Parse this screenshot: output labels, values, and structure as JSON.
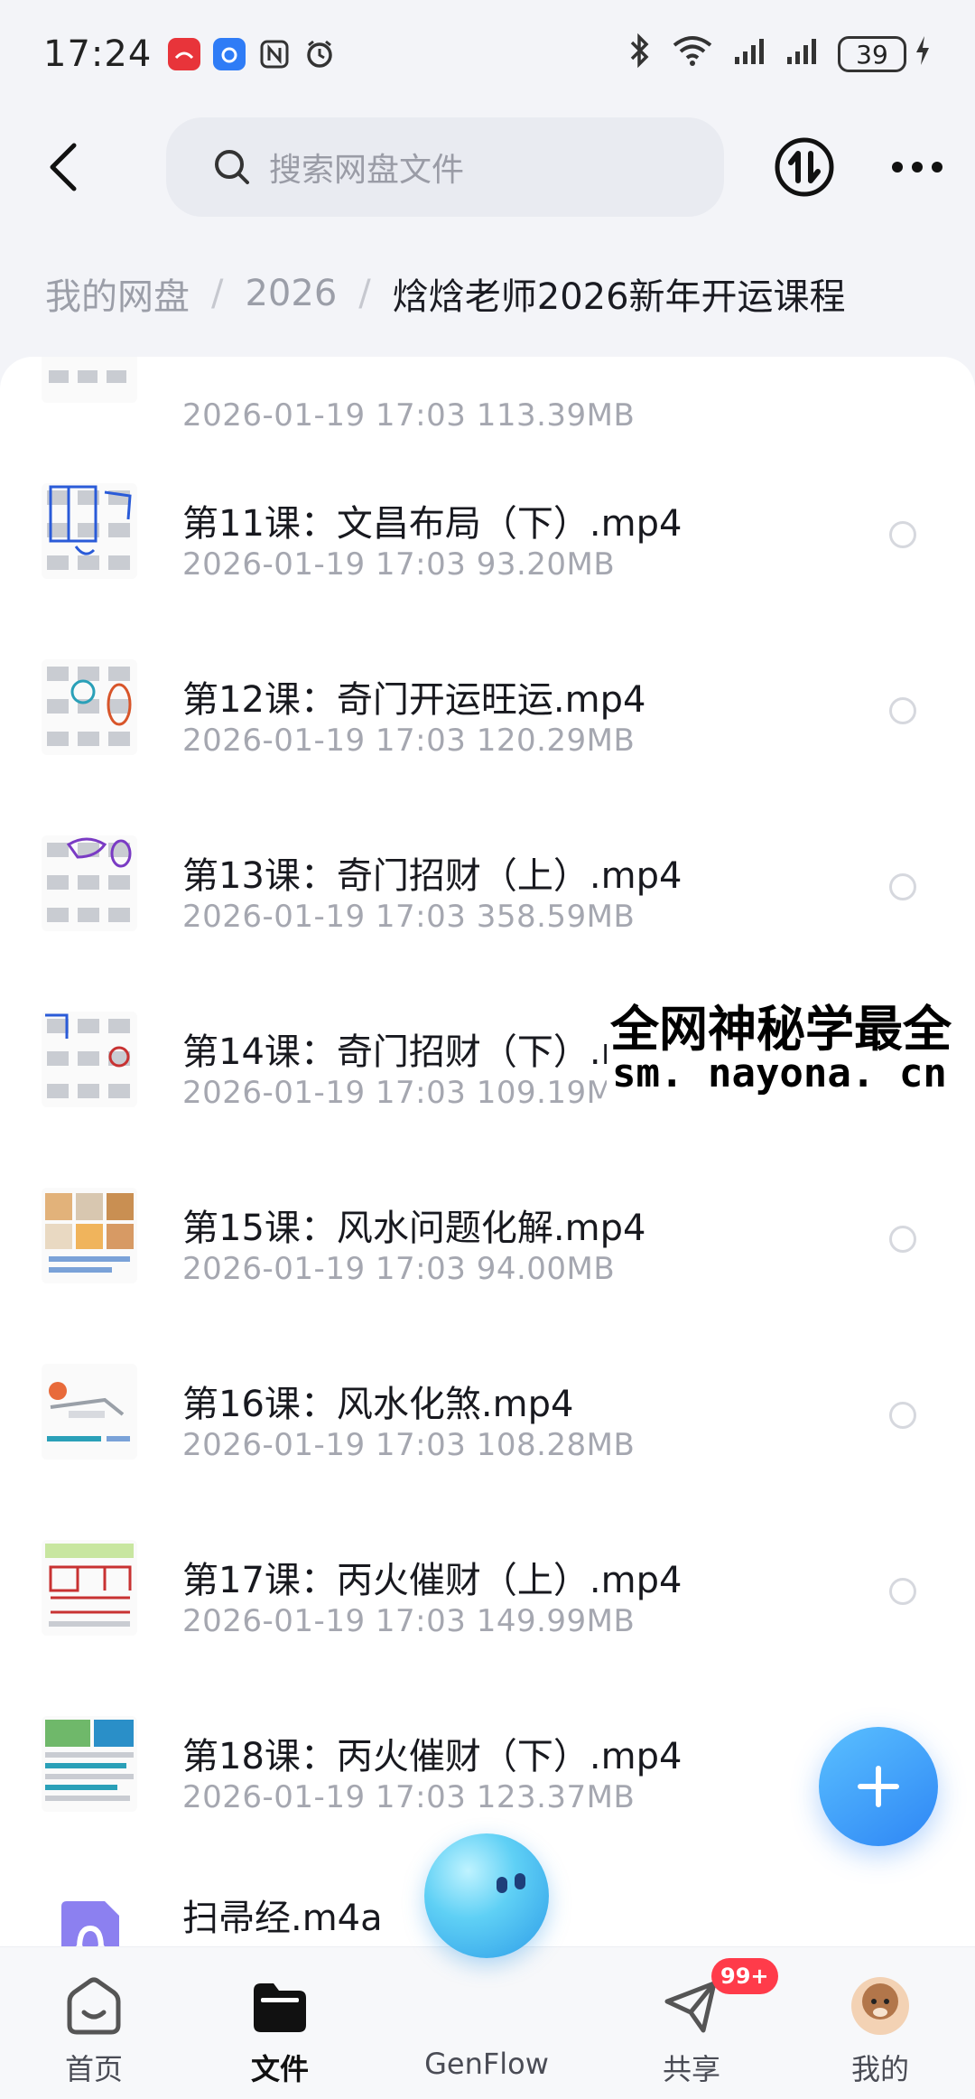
{
  "status_bar": {
    "time": "17:24",
    "battery": "39",
    "app_icons": [
      "huawei-app-icon",
      "alarm-app-icon",
      "nfc-icon",
      "clock-icon"
    ]
  },
  "top_bar": {
    "search_placeholder": "搜索网盘文件"
  },
  "breadcrumb": {
    "root": "我的网盘",
    "level1": "2026",
    "current": "焓焓老师2026新年开运课程"
  },
  "files": [
    {
      "name": "",
      "meta": "2026-01-19  17:03  113.39MB",
      "partial": true
    },
    {
      "name": "第11课：文昌布局（下）.mp4",
      "meta": "2026-01-19  17:03  93.20MB"
    },
    {
      "name": "第12课：奇门开运旺运.mp4",
      "meta": "2026-01-19  17:03  120.29MB"
    },
    {
      "name": "第13课：奇门招财（上）.mp4",
      "meta": "2026-01-19  17:03  358.59MB"
    },
    {
      "name": "第14课：奇门招财（下）.mp4",
      "meta": "2026-01-19  17:03  109.19MB"
    },
    {
      "name": "第15课：风水问题化解.mp4",
      "meta": "2026-01-19  17:03  94.00MB"
    },
    {
      "name": "第16课：风水化煞.mp4",
      "meta": "2026-01-19  17:03  108.28MB"
    },
    {
      "name": "第17课：丙火催财（上）.mp4",
      "meta": "2026-01-19  17:03  149.99MB"
    },
    {
      "name": "第18课：丙火催财（下）.mp4",
      "meta": "2026-01-19  17:03  123.37MB"
    },
    {
      "name": "扫帚经.m4a",
      "meta": ""
    }
  ],
  "watermark": {
    "line1": "全网神秘学最全",
    "line2": "sm. nayona. cn"
  },
  "bottom_nav": {
    "home": "首页",
    "files": "文件",
    "genflow": "GenFlow",
    "share": "共享",
    "mine": "我的",
    "share_badge": "99+"
  },
  "colors": {
    "accent": "#2e86f5",
    "badge": "#ff3b4a"
  }
}
